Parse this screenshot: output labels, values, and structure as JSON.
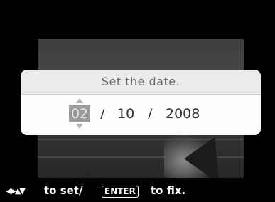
{
  "dialog": {
    "title": "Set the date.",
    "day": "02",
    "month": "10",
    "year": "2008",
    "separator": "/"
  },
  "footer": {
    "nav_icons": "◀▶▲▼",
    "set_text": "to set/",
    "enter_label": "ENTER",
    "fix_text": "to fix."
  },
  "icons": {
    "up": "arrow-up-icon",
    "down": "arrow-down-icon"
  }
}
